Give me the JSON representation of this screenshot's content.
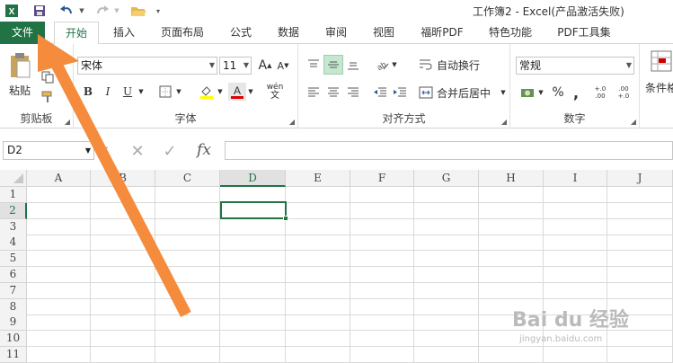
{
  "window": {
    "title": "工作簿2 - Excel(产品激活失败)"
  },
  "quick_access": {
    "excel_icon": "excel-logo-icon",
    "save_icon": "save-icon",
    "undo_icon": "undo-icon",
    "redo_icon": "redo-icon",
    "open_icon": "folder-open-icon",
    "more_icon": "chevron-down-icon"
  },
  "tabs": [
    {
      "label": "文件"
    },
    {
      "label": "开始"
    },
    {
      "label": "插入"
    },
    {
      "label": "页面布局"
    },
    {
      "label": "公式"
    },
    {
      "label": "数据"
    },
    {
      "label": "审阅"
    },
    {
      "label": "视图"
    },
    {
      "label": "福昕PDF"
    },
    {
      "label": "特色功能"
    },
    {
      "label": "PDF工具集"
    }
  ],
  "ribbon": {
    "clipboard": {
      "label": "剪贴板",
      "paste_label": "粘贴"
    },
    "font": {
      "label": "字体",
      "font_name": "宋体",
      "font_size": "11",
      "bold": "B",
      "italic": "I",
      "underline": "U",
      "increase": "A",
      "decrease": "A",
      "wen": "wén",
      "wen_char": "文"
    },
    "alignment": {
      "label": "对齐方式",
      "wrap_text": "自动换行",
      "merge_center": "合并后居中"
    },
    "number": {
      "label": "数字",
      "format": "常规",
      "percent": "%",
      "comma": ",",
      "inc_decimal": "+.0 .00",
      "dec_decimal": ".00 +.0"
    },
    "styles": {
      "conditional_label": "条件格"
    }
  },
  "formula_bar": {
    "name_box": "D2",
    "fx": "fx",
    "cancel": "✕",
    "enter": "✓",
    "dots": "⋮"
  },
  "sheet": {
    "columns": [
      "A",
      "B",
      "C",
      "D",
      "E",
      "F",
      "G",
      "H",
      "I",
      "J"
    ],
    "rows": [
      "1",
      "2",
      "3",
      "4",
      "5",
      "6",
      "7",
      "8",
      "9",
      "10",
      "11"
    ],
    "selected_cell": "D2"
  },
  "watermark": {
    "text": "Bai du 经验",
    "sub": "jingyan.baidu.com"
  },
  "colors": {
    "excel_green": "#217346",
    "arrow": "#f58b3c"
  }
}
